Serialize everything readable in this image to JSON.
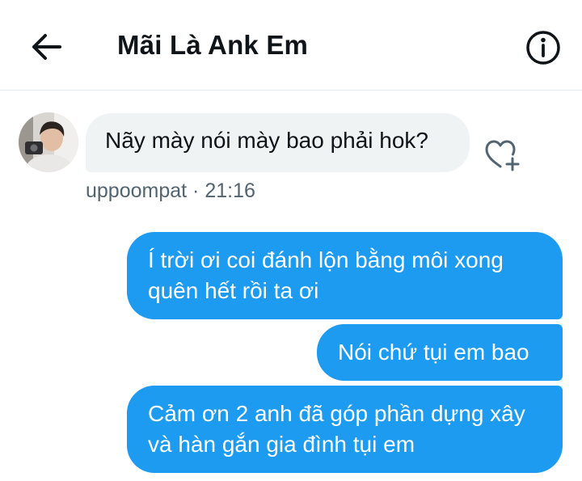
{
  "header": {
    "title": "Mãi Là Ank Em",
    "back_icon": "arrow-left-icon",
    "info_icon": "info-icon"
  },
  "incoming": {
    "avatar": "user-avatar",
    "text": "Nãy mày nói mày bao phải hok?",
    "meta": "uppoompat · 21:16",
    "react_icon": "heart-plus-icon"
  },
  "outgoing": [
    {
      "lines": [
        "Í trời ơi coi đánh lộn bằng môi xong",
        "quên hết rồi ta ơi"
      ]
    },
    {
      "lines": [
        "Nói chứ tụi em bao"
      ]
    },
    {
      "lines": [
        "Cảm ơn 2 anh đã góp phần dựng xây",
        "và hàn gắn gia đình tụi em"
      ]
    }
  ],
  "colors": {
    "accent": "#1d9bf0",
    "incoming_bubble": "#eff3f4",
    "text": "#0f1419",
    "meta": "#536471"
  }
}
